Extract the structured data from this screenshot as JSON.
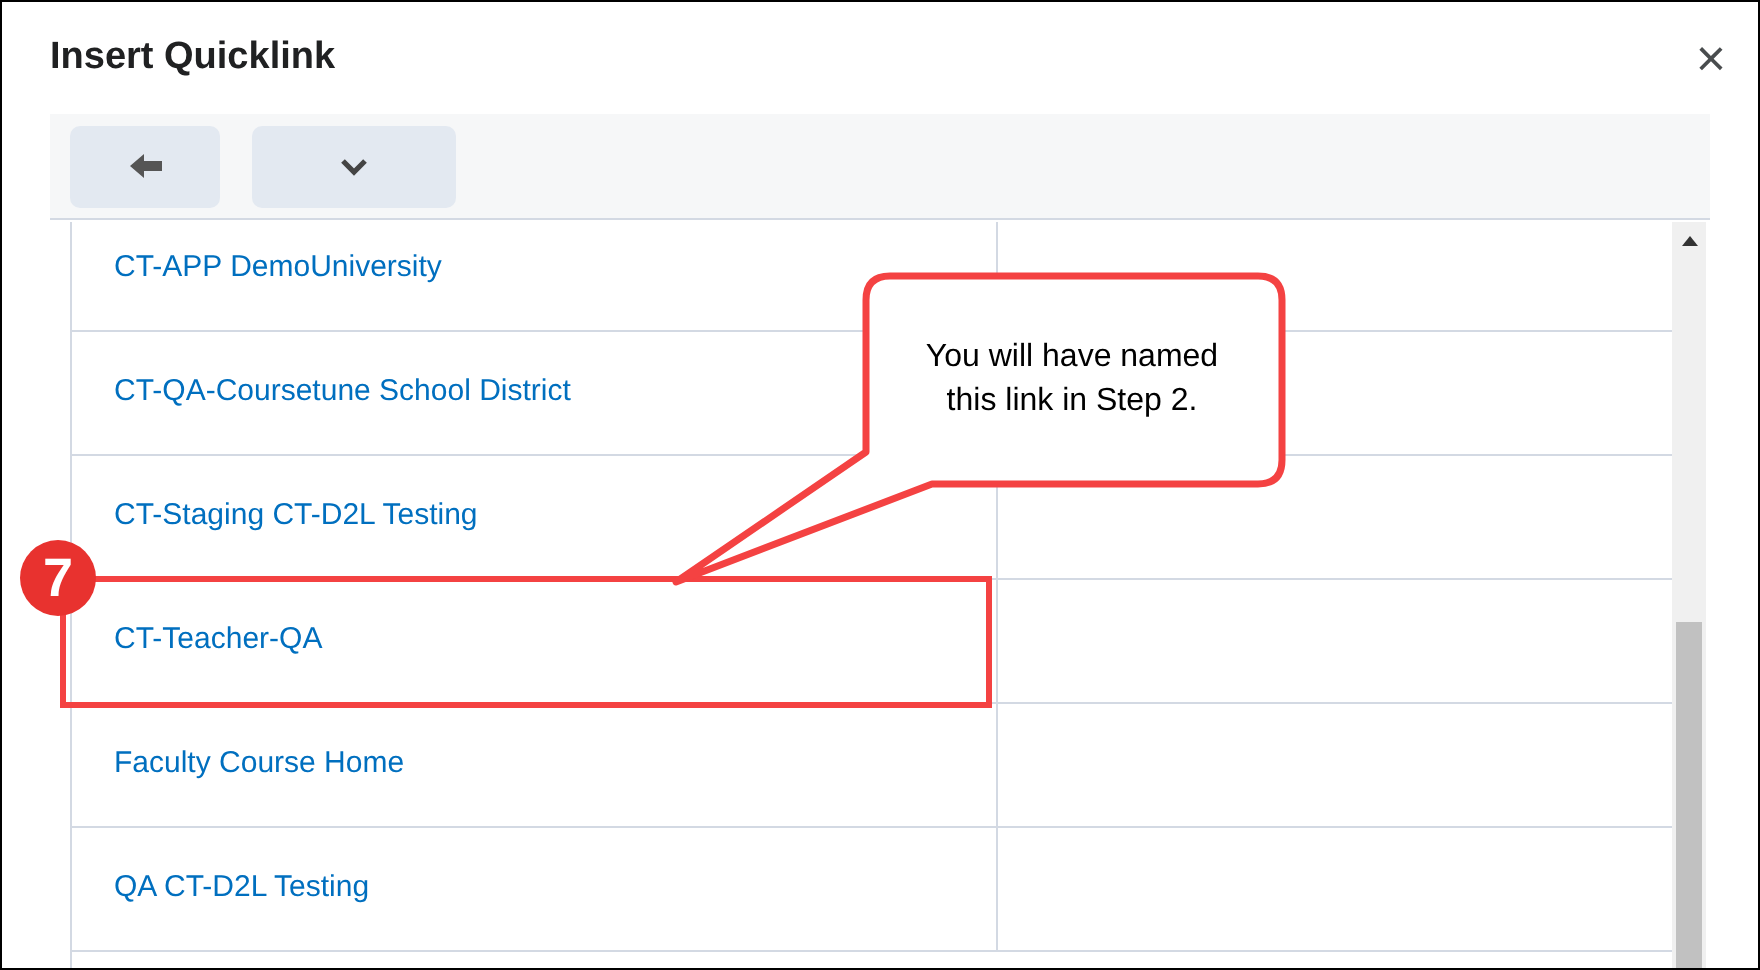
{
  "dialog": {
    "title": "Insert Quicklink",
    "close": "×"
  },
  "toolbar": [
    {
      "kind": "back"
    },
    {
      "kind": "menu"
    }
  ],
  "rows": [
    {
      "label": "CT-APP DemoUniversity",
      "highlighted": false
    },
    {
      "label": "CT-QA-Coursetune School District",
      "highlighted": false
    },
    {
      "label": "CT-Staging CT-D2L Testing",
      "highlighted": false
    },
    {
      "label": "CT-Teacher-QA",
      "highlighted": true
    },
    {
      "label": "Faculty Course Home",
      "highlighted": false
    },
    {
      "label": "QA CT-D2L Testing",
      "highlighted": false
    }
  ],
  "annotation": {
    "step": "7",
    "callout": "You will have named this link in Step 2."
  }
}
